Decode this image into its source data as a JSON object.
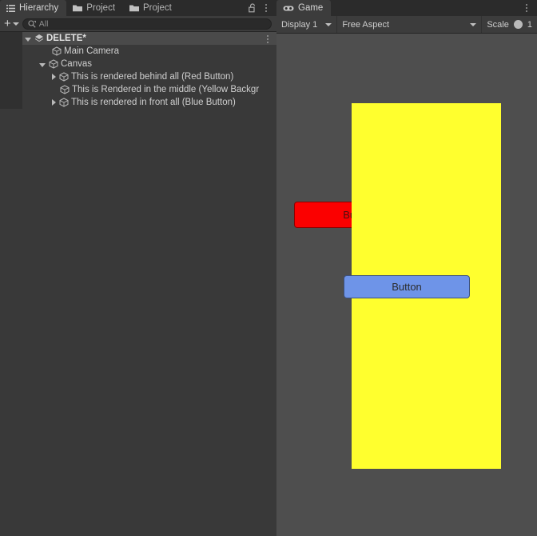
{
  "hierarchy_panel": {
    "tabs": [
      {
        "label": "Hierarchy",
        "icon": "hierarchy-icon",
        "active": true
      },
      {
        "label": "Project",
        "icon": "folder-icon",
        "active": false
      },
      {
        "label": "Project",
        "icon": "folder-icon",
        "active": false
      }
    ],
    "tools": {
      "lock_icon": "lock-open-icon",
      "menu_icon": "kebab-menu-icon"
    },
    "toolbar": {
      "add_label": "+",
      "add_dropdown_icon": "chevron-down-icon",
      "search_icon": "search-icon",
      "search_placeholder": "All",
      "search_value": ""
    },
    "tree": [
      {
        "label": "DELETE*",
        "icon": "scene-icon",
        "depth": 0,
        "expanded": true,
        "has_children": true,
        "selected": true,
        "bold": true,
        "menu_icon": "kebab-menu-icon"
      },
      {
        "label": "Main Camera",
        "icon": "gameobject-icon",
        "depth": 1,
        "expanded": false,
        "has_children": false,
        "selected": false,
        "bold": false
      },
      {
        "label": "Canvas",
        "icon": "gameobject-icon",
        "depth": 1,
        "expanded": true,
        "has_children": true,
        "selected": false,
        "bold": false
      },
      {
        "label": "This is rendered behind all (Red Button)",
        "icon": "gameobject-icon",
        "depth": 2,
        "expanded": false,
        "has_children": true,
        "selected": false,
        "bold": false
      },
      {
        "label": "This is Rendered in the middle (Yellow Backgr",
        "icon": "gameobject-icon",
        "depth": 2,
        "expanded": false,
        "has_children": false,
        "selected": false,
        "bold": false
      },
      {
        "label": "This is rendered in front all (Blue Button)",
        "icon": "gameobject-icon",
        "depth": 2,
        "expanded": false,
        "has_children": true,
        "selected": false,
        "bold": false
      }
    ]
  },
  "game_panel": {
    "tabs": [
      {
        "label": "Game",
        "icon": "gamepad-icon",
        "active": true
      }
    ],
    "tools": {
      "menu_icon": "kebab-menu-icon"
    },
    "toolbar": {
      "display": "Display 1",
      "display_dropdown_icon": "chevron-down-icon",
      "aspect": "Free Aspect",
      "aspect_dropdown_icon": "chevron-down-icon",
      "scale_label": "Scale",
      "scale_value": "1"
    },
    "content": {
      "yellow_background": {
        "color": "#ffff2e",
        "label": ""
      },
      "red_button": {
        "label": "Button",
        "color": "#fb0000",
        "text_color": "#4a1010"
      },
      "blue_button": {
        "label": "Button",
        "color": "#6e94e8",
        "text_color": "#2c2c2c"
      }
    }
  }
}
